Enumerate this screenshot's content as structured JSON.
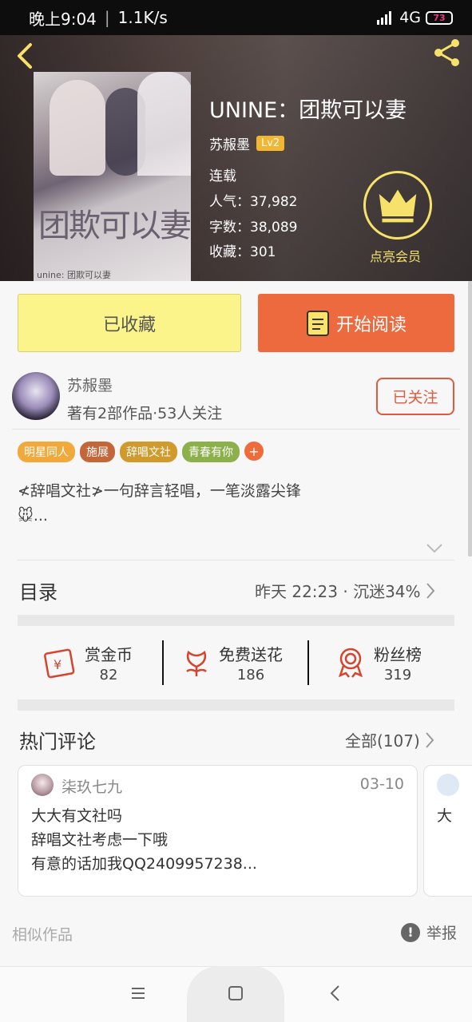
{
  "status_bar": {
    "time": "晚上9:04",
    "speed": "1.1K/s",
    "network": "4G",
    "battery": "73"
  },
  "book": {
    "title": "UNINE：团欺可以妻",
    "author": "苏赧墨",
    "level": "Lv2",
    "status": "连载",
    "popularity": "人气：37,982",
    "word_count": "字数：38,089",
    "favorites": "收藏：301",
    "cover_title": "团欺可以妻",
    "cover_sub": "unine: 团欺可以妻"
  },
  "vip": {
    "label": "点亮会员"
  },
  "actions": {
    "collected_label": "已收藏",
    "read_label": "开始阅读"
  },
  "author_card": {
    "name": "苏赧墨",
    "stats": "著有2部作品·53人关注",
    "follow_label": "已关注"
  },
  "tags": [
    {
      "label": "明星同人",
      "color": "#f2a93b"
    },
    {
      "label": "施展",
      "color": "#c3673b"
    },
    {
      "label": "辞唱文社",
      "color": "#d09a2c"
    },
    {
      "label": "青春有你",
      "color": "#8cb04a"
    }
  ],
  "tag_add": "+",
  "description": {
    "line1": "≮辞唱文社≯一句辞言轻唱，一笔淡露尖锋",
    "line2": "🐭..."
  },
  "catalog": {
    "title": "目录",
    "update": "昨天 22:23 · 沉迷34%"
  },
  "rewards": [
    {
      "label": "赏金币",
      "value": "82",
      "icon": "coin-icon"
    },
    {
      "label": "免费送花",
      "value": "186",
      "icon": "flower-icon"
    },
    {
      "label": "粉丝榜",
      "value": "319",
      "icon": "medal-icon"
    }
  ],
  "comments": {
    "title": "热门评论",
    "all_label": "全部(107)",
    "items": [
      {
        "user": "柒玖七九",
        "date": "03-10",
        "line1": "大大有文社吗",
        "line2": "辞唱文社考虑一下哦",
        "line3": "有意的话加我QQ2409957238..."
      },
      {
        "user": "",
        "date": "",
        "line1": "大",
        "line2": "",
        "line3": ""
      }
    ]
  },
  "footer": {
    "similar_label": "相似作品",
    "report_label": "举报",
    "report_icon": "!"
  },
  "colors": {
    "accent_orange": "#ec6a3d",
    "collected_yellow": "#fbf48a",
    "vip_gold": "#f6e26b",
    "follow_red": "#e05a3f"
  }
}
